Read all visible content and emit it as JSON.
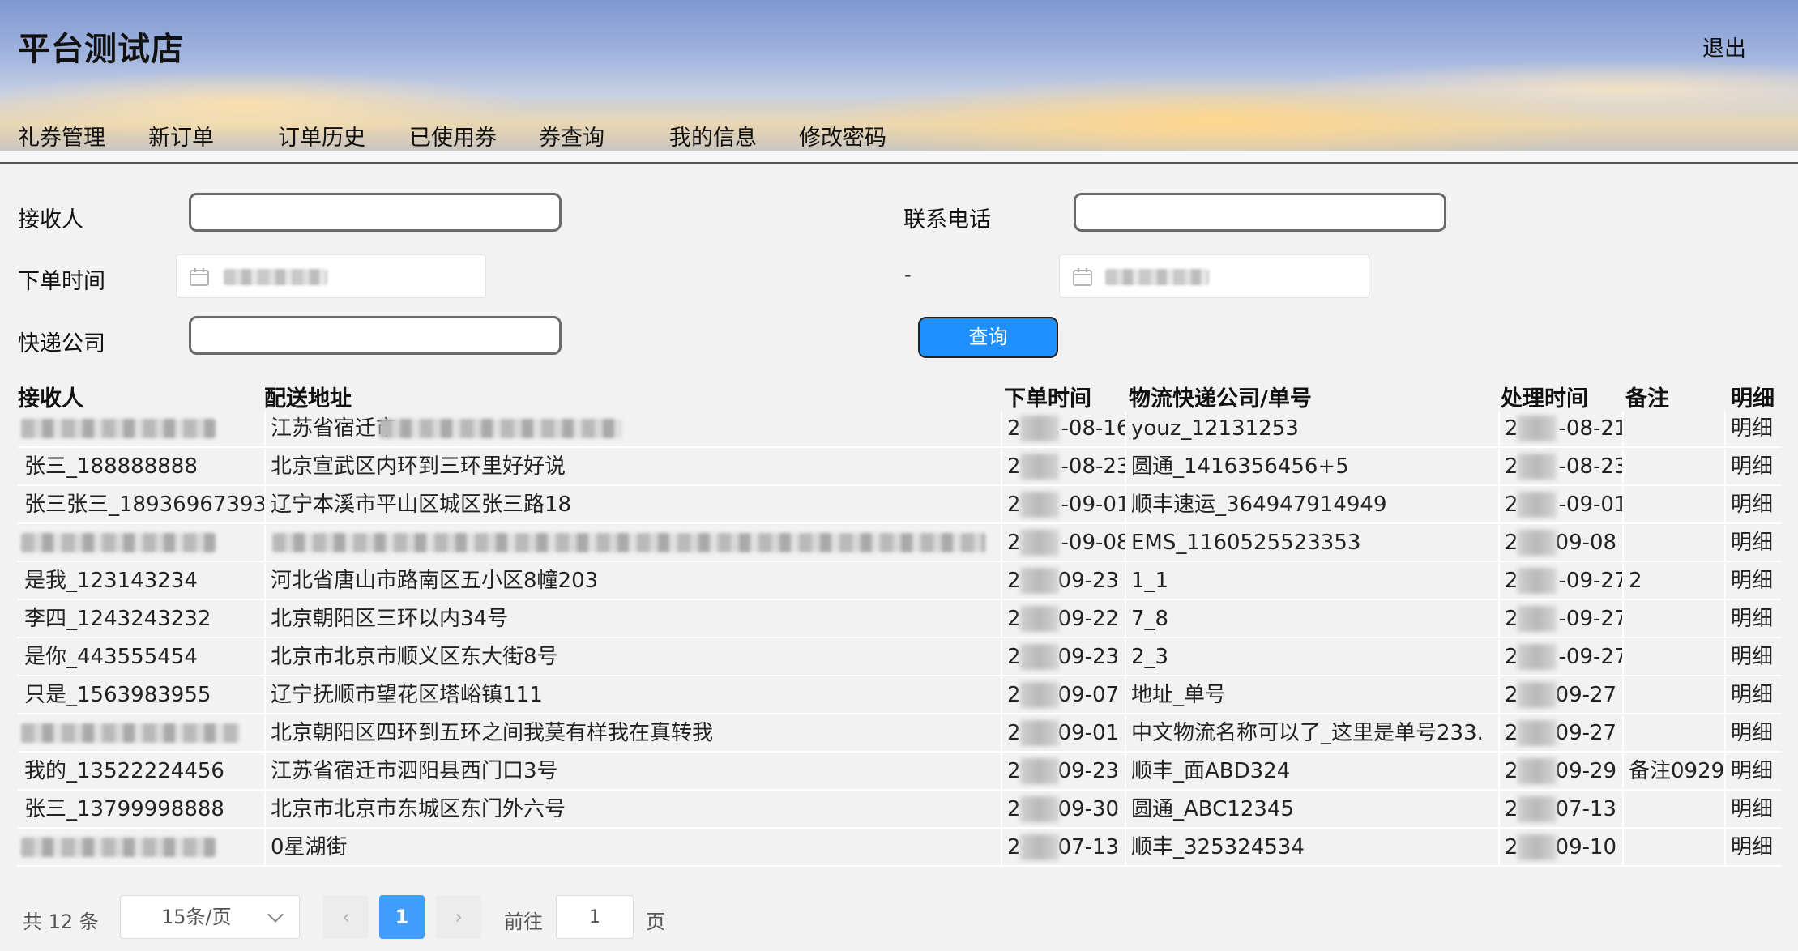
{
  "header": {
    "brand": "平台测试店",
    "logout": "退出",
    "nav": [
      "礼券管理",
      "新订单",
      "订单历史",
      "已使用券",
      "券查询",
      "我的信息",
      "修改密码"
    ]
  },
  "form": {
    "receiver_label": "接收人",
    "receiver_value": "",
    "phone_label": "联系电话",
    "phone_value": "",
    "order_time_label": "下单时间",
    "range_separator": "-",
    "courier_label": "快递公司",
    "courier_value": "",
    "query_button": "查询"
  },
  "table": {
    "headers": [
      "接收人",
      "配送地址",
      "下单时间",
      "物流快递公司/单号",
      "处理时间",
      "备注",
      "明细"
    ],
    "rows": [
      {
        "receiver": "",
        "receiver_blurred": true,
        "address": "江苏省宿迁市",
        "address_blurred": true,
        "order_time": "-08-16",
        "logistics": "youz_12131253",
        "process_time": "-08-21",
        "note": "",
        "detail": "明细"
      },
      {
        "receiver": "张三_188888888",
        "address": "北京宣武区内环到三环里好好说",
        "order_time": "-08-23",
        "logistics": "圆通_1416356456+5",
        "process_time": "-08-23",
        "note": "",
        "detail": "明细"
      },
      {
        "receiver": "张三张三_18936967393",
        "address": "辽宁本溪市平山区城区张三路18",
        "order_time": "-09-01",
        "logistics": "顺丰速运_364947914949",
        "process_time": "-09-01",
        "note": "",
        "detail": "明细"
      },
      {
        "receiver": "",
        "receiver_blurred": true,
        "address": "",
        "address_blurred": true,
        "order_time": "-09-08",
        "logistics": "EMS_1160525523353",
        "process_time": "09-08",
        "note": "",
        "detail": "明细"
      },
      {
        "receiver": "是我_123143234",
        "address": "河北省唐山市路南区五小区8幢203",
        "order_time": "09-23",
        "logistics": "1_1",
        "process_time": "-09-27",
        "note": "2",
        "detail": "明细"
      },
      {
        "receiver": "李四_1243243232",
        "address": "北京朝阳区三环以内34号",
        "order_time": "09-22",
        "logistics": "7_8",
        "process_time": "-09-27",
        "note": "",
        "detail": "明细"
      },
      {
        "receiver": "是你_443555454",
        "address": "北京市北京市顺义区东大街8号",
        "order_time": "09-23",
        "logistics": "2_3",
        "process_time": "-09-27",
        "note": "",
        "detail": "明细"
      },
      {
        "receiver": "只是_1563983955",
        "address": "辽宁抚顺市望花区塔峪镇111",
        "order_time": "09-07",
        "logistics": "地址_单号",
        "process_time": "09-27",
        "note": "",
        "detail": "明细"
      },
      {
        "receiver": "",
        "receiver_blurred": true,
        "address": "北京朝阳区四环到五环之间我莫有样我在真转我",
        "order_time": "09-01",
        "logistics": "中文物流名称可以了_这里是单号233.",
        "process_time": "09-27",
        "note": "",
        "detail": "明细"
      },
      {
        "receiver": "我的_13522224456",
        "address": "江苏省宿迁市泗阳县西门口3号",
        "order_time": "09-23",
        "logistics": "顺丰_面ABD324",
        "process_time": "09-29",
        "note": "备注0929",
        "detail": "明细"
      },
      {
        "receiver": "张三_13799998888",
        "address": "北京市北京市东城区东门外六号",
        "order_time": "09-30",
        "logistics": "圆通_ABC12345",
        "process_time": "07-13",
        "note": "",
        "detail": "明细"
      },
      {
        "receiver": "",
        "receiver_blurred": true,
        "address": "0星湖街",
        "order_time": "07-13",
        "logistics": "顺丰_325324534",
        "process_time": "09-10",
        "note": "",
        "detail": "明细"
      }
    ]
  },
  "pagination": {
    "total": "共 12 条",
    "page_size": "15条/页",
    "current_page": "1",
    "goto_label": "前往",
    "goto_value": "1",
    "page_suffix": "页"
  },
  "colors": {
    "primary": "#1e90ff",
    "page_active": "#409eff",
    "background": "#f2f2f2"
  }
}
